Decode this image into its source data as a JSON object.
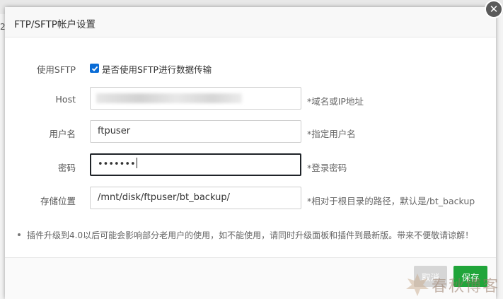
{
  "backdrop": {
    "edge_char": "2"
  },
  "dialog": {
    "title": "FTP/SFTP帐户设置",
    "close_glyph": "✕",
    "sftp": {
      "label": "使用SFTP",
      "checkbox_label": "是否使用SFTP进行数据传输",
      "checked": true
    },
    "host": {
      "label": "Host",
      "hint": "*域名或IP地址"
    },
    "username": {
      "label": "用户名",
      "value": "ftpuser",
      "hint": "*指定用户名"
    },
    "password": {
      "label": "密码",
      "value": "•••••••",
      "hint": "*登录密码"
    },
    "storage": {
      "label": "存储位置",
      "value": "/mnt/disk/ftpuser/bt_backup/",
      "hint": "*相对于根目录的路径，默认是/bt_backup"
    },
    "notice": "插件升级到4.0以后可能会影响部分老用户的使用，如不能使用，请同时升级面板和插件到最新版。带来不便敬请谅解！",
    "buttons": {
      "cancel": "取消",
      "save": "保存"
    }
  },
  "watermark": {
    "text": "春秋博客"
  },
  "colors": {
    "accent": "#20a53a",
    "checkbox": "#0a6cd6"
  }
}
